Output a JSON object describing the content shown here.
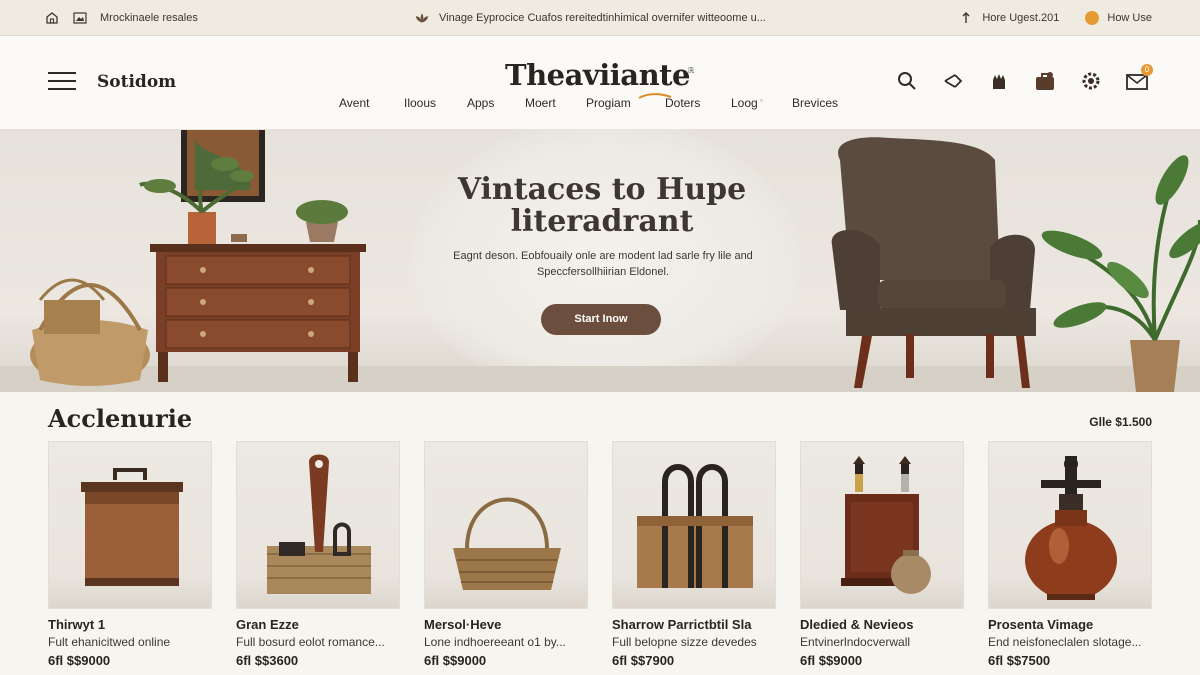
{
  "topbar": {
    "left_text": "Mrockinaele resales",
    "center_text": "Vinage Eyprocice Cuafos rereitedtinhimical overnifer witteoome u...",
    "right_text": "Hore Ugest.201",
    "right_link": "How Use"
  },
  "header": {
    "store_name": "Sotidom",
    "brand": "Theaviiante",
    "brand_sup": "ℝ",
    "nav": [
      "Avent",
      "Iloous",
      "Apps",
      "Moert",
      "Progiam",
      "Doters",
      "Loog",
      "Brevices"
    ],
    "nav_marker": "▫",
    "cart_count": "0"
  },
  "hero": {
    "title": "Vintaces to Hupe literadrant",
    "text": "Eagnt deson. Eobfouaily onle are modent lad sarle fry lile and Speccfersollhiirian Eldonel.",
    "cta": "Start Inow"
  },
  "section": {
    "title": "Acclenurie",
    "link": "Glle $1.500"
  },
  "products": [
    {
      "name": "Thirwyt 1",
      "desc": "Fult ehanicitwed online",
      "price": "$9000",
      "currency_prefix": "6fl $"
    },
    {
      "name": "Gran Ezze",
      "desc": "Full bosurd eolot romance...",
      "price": "$3600",
      "currency_prefix": "6fl $"
    },
    {
      "name": "Mersol·Heve",
      "desc": "Lone indhoereeant o1 by...",
      "price": "$9000",
      "currency_prefix": "6fl $"
    },
    {
      "name": "Sharrow Parrictbtil Sla",
      "desc": "Full belopne sizze devedes",
      "price": "$7900",
      "currency_prefix": "6fl $"
    },
    {
      "name": "Dledied & Nevieos",
      "desc": "Entvinerlndocverwall",
      "price": "$9000",
      "currency_prefix": "6fl $"
    },
    {
      "name": "Prosenta Vimage",
      "desc": "End neisfoneclalen slotage...",
      "price": "$7500",
      "currency_prefix": "6fl $"
    }
  ],
  "colors": {
    "accent": "#6b4e3e",
    "badge": "#e59a33",
    "topbar_bg": "#efebe1"
  },
  "icons": [
    "home-icon",
    "image-icon",
    "leaf-icon",
    "arrow-up-icon",
    "menu-icon",
    "search-icon",
    "share-icon",
    "hand-icon",
    "bag-icon",
    "settings-icon",
    "mail-icon"
  ]
}
